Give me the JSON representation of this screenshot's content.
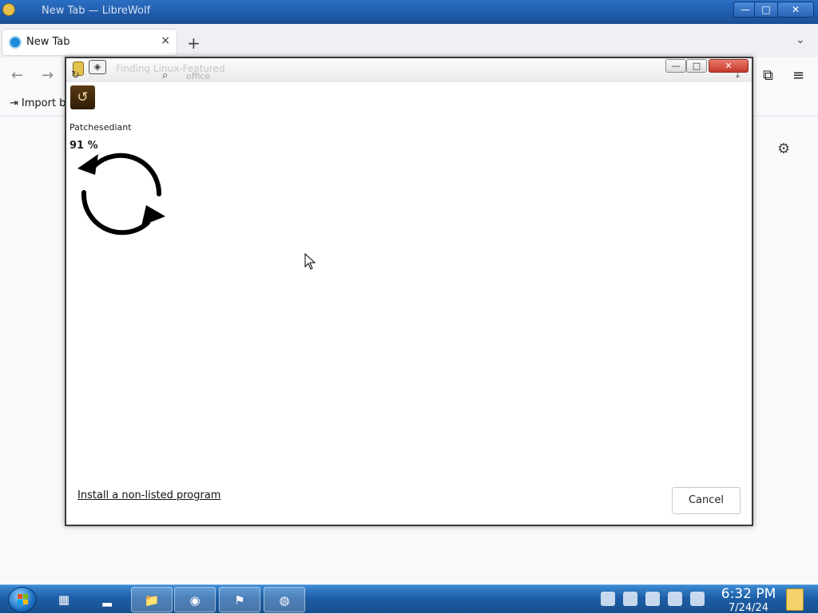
{
  "browser": {
    "window_title": "New Tab — LibreWolf",
    "controls": {
      "minimize": "—",
      "maximize": "□",
      "close": "✕"
    },
    "tab": {
      "label": "New Tab",
      "close": "×"
    },
    "new_tab": "+",
    "tab_list": "⌄",
    "nav": {
      "back": "←",
      "forward": "→",
      "extensions": "⧉",
      "menu": "≡"
    },
    "bookmarks": {
      "import_label": "Import b",
      "import_icon": "⇥"
    },
    "settings_icon": "⚙"
  },
  "dialog": {
    "title_ghost": "Finding Linux-Featured",
    "title_ghost2": "office",
    "controls": {
      "minimize": "—",
      "maximize": "□",
      "close": "✕"
    },
    "toolbar": {
      "refresh": "↻",
      "search": "⌕",
      "download": "⤓"
    },
    "status_text": "Patchesediant",
    "progress_text": "91 %",
    "banner_icon": "↺",
    "install_link": "Install a non-listed program",
    "cancel_label": "Cancel"
  },
  "taskbar": {
    "clock": {
      "time": "6:32 PM",
      "date": "7/24/24"
    },
    "items": [
      "▦",
      "▂",
      "📁",
      "◉",
      "⚑",
      "◍"
    ]
  },
  "colors": {
    "accent": "#1f5aa8",
    "taskbar": "#1d5ea6",
    "dialog_close": "#c4392a"
  }
}
